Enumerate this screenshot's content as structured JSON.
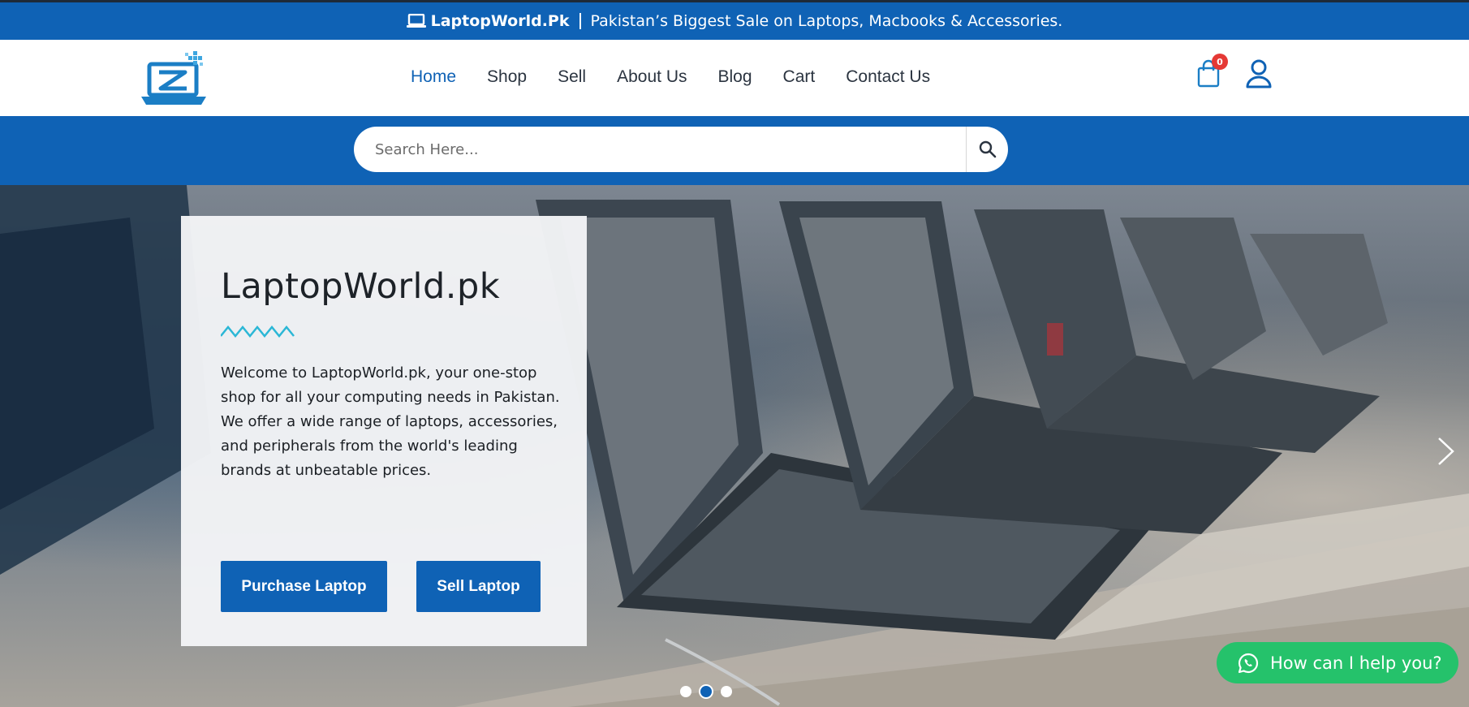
{
  "topbar": {
    "brand": "LaptopWorld.Pk",
    "tagline": "Pakistan’s Biggest Sale on Laptops, Macbooks & Accessories.",
    "brand_icon": "laptop-icon"
  },
  "header": {
    "logo_icon": "laptop-logo-icon",
    "nav": [
      {
        "label": "Home",
        "active": true
      },
      {
        "label": "Shop"
      },
      {
        "label": "Sell"
      },
      {
        "label": "About Us"
      },
      {
        "label": "Blog"
      },
      {
        "label": "Cart"
      },
      {
        "label": "Contact Us"
      }
    ],
    "cart_count": "0",
    "cart_icon": "shopping-bag-icon",
    "user_icon": "user-icon"
  },
  "search": {
    "placeholder": "Search Here...",
    "icon": "search-icon"
  },
  "hero": {
    "title": "LaptopWorld.pk",
    "description": "Welcome to LaptopWorld.pk, your one-stop shop for all your computing needs in Pakistan. We offer a wide range of laptops, accessories, and peripherals from the world's leading brands at unbeatable prices.",
    "buttons": {
      "purchase": "Purchase Laptop",
      "sell": "Sell Laptop"
    },
    "slides": 3,
    "active_slide": 2
  },
  "whatsapp": {
    "label": "How can I help you?",
    "icon": "whatsapp-icon"
  },
  "colors": {
    "brand_blue": "#0f62b5",
    "whatsapp_green": "#25c26b",
    "badge_red": "#e53935"
  }
}
